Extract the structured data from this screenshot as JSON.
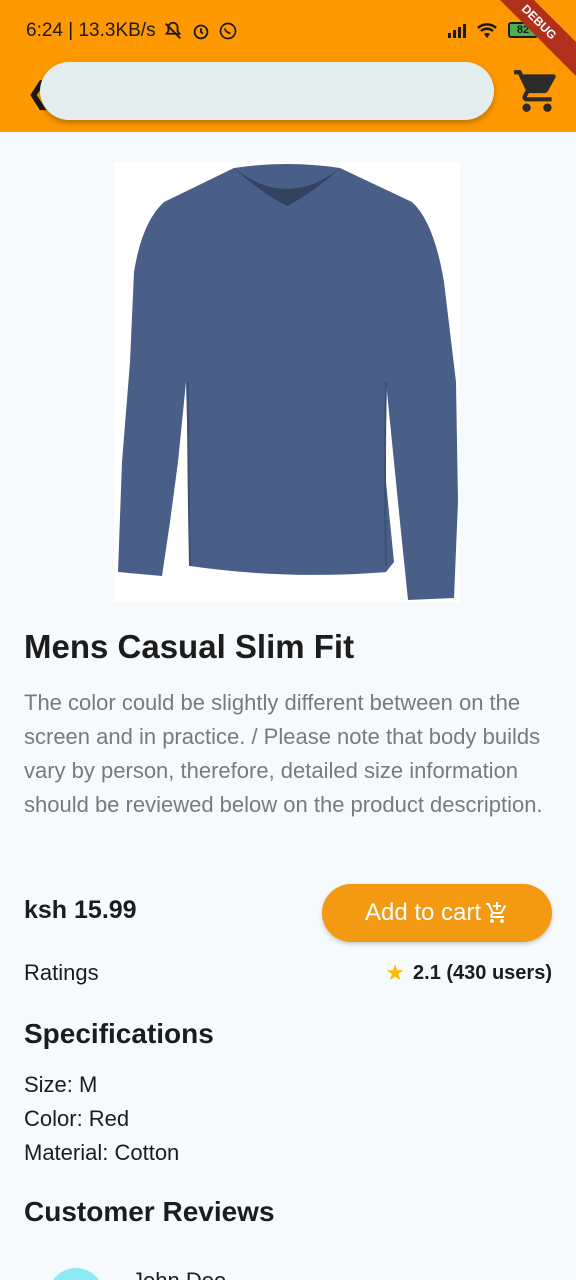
{
  "status_bar": {
    "time_speed": "6:24 | 13.3KB/s",
    "battery": "82"
  },
  "debug_banner": "DEBUG",
  "search": {
    "value": "",
    "placeholder": ""
  },
  "product": {
    "title": "Mens Casual Slim Fit",
    "description": "The color could be slightly different between on the screen and in practice. / Please note that body builds vary by person, therefore, detailed size information should be reviewed below on the product description.",
    "price": "ksh 15.99",
    "add_to_cart_label": "Add to cart",
    "ratings_label": "Ratings",
    "rating_value": "2.1 (430 users)"
  },
  "specifications": {
    "heading": "Specifications",
    "size": "Size: M",
    "color": "Color: Red",
    "material": "Material: Cotton"
  },
  "reviews": {
    "heading": "Customer Reviews",
    "items": [
      {
        "name": "John Doe"
      }
    ]
  },
  "colors": {
    "appbar": "#fd9800",
    "button": "#f39a12",
    "star": "#fbbc05"
  }
}
